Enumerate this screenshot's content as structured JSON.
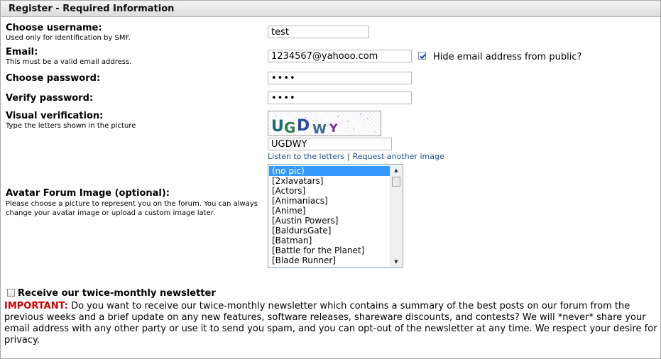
{
  "section_title": "Register - Required Information",
  "username": {
    "label": "Choose username:",
    "hint": "Used only for identification by SMF.",
    "value": "test"
  },
  "email": {
    "label": "Email:",
    "hint": "This must be a valid email address.",
    "value": "1234567@yahooo.com",
    "hide_label": "Hide email address from public?",
    "hide_checked": true
  },
  "password": {
    "label": "Choose password:",
    "value": "••••"
  },
  "verify": {
    "label": "Verify password:",
    "value": "••••"
  },
  "visual": {
    "label": "Visual verification:",
    "hint": "Type the letters shown in the picture",
    "captcha_text": "UGDWY",
    "value": "UGDWY",
    "listen_link": "Listen to the letters",
    "separator": "|",
    "request_link": "Request another image"
  },
  "avatar": {
    "label": "Avatar Forum Image (optional):",
    "hint": "Please choose a picture to represent you on the forum. You can always change your avatar image or upload a custom image later.",
    "options": [
      "(no pic)",
      "[2xlavatars]",
      "[Actors]",
      "[Animaniacs]",
      "[Anime]",
      "[Austin Powers]",
      "[BaldursGate]",
      "[Batman]",
      "[Battle for the Planet]",
      "[Blade Runner]"
    ],
    "selected_index": 0
  },
  "newsletter": {
    "label": "Receive our twice-monthly newsletter",
    "checked": false,
    "important_label": "IMPORTANT:",
    "description": "Do you want to receive our twice-monthly newsletter which contains a summary of the best posts on our forum from the previous weeks and a brief update on any new features, software releases, shareware discounts, and contests? We will *never* share your email address with any other party or use it to send you spam, and you can opt-out of the newsletter at any time. We respect your desire for privacy."
  },
  "colors": {
    "header_bg": "#dcdcdc",
    "link": "#1f4f8f",
    "important": "#cc0000",
    "selection": "#3399ff"
  }
}
